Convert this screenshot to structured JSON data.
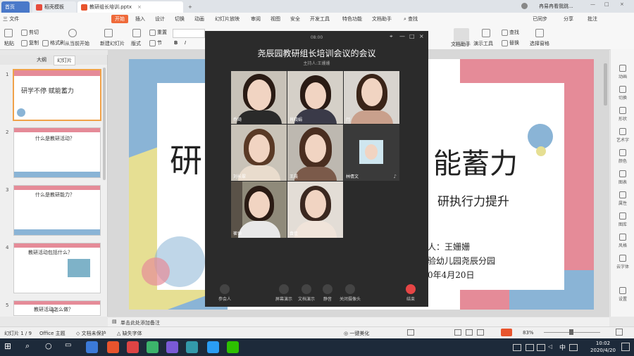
{
  "tabs": {
    "home": "首页",
    "template": "稻壳模板",
    "document": "教研组长培训.pptx",
    "new_tab": "+",
    "user": "冉易冉看我跳..."
  },
  "menu": {
    "file": "三 文件",
    "items": [
      "开始",
      "插入",
      "设计",
      "切换",
      "动画",
      "幻灯片放映",
      "审阅",
      "视图",
      "安全",
      "开发工具",
      "特色功能",
      "文档助手"
    ],
    "search": "查找",
    "sync": "已同步",
    "share": "分享",
    "annotate": "批注"
  },
  "ribbon": {
    "paste": "粘贴",
    "cut": "剪切",
    "copy": "复制",
    "format_painter": "格式刷",
    "from_current": "从当前开始",
    "new_slide": "新建幻灯片",
    "layout": "版式",
    "section": "节",
    "reset": "重置",
    "bold": "B",
    "italic": "I",
    "doc_assistant": "文档助手",
    "presenter_tools": "演示工具",
    "find": "查找",
    "replace": "替换",
    "select_pane": "选择窗格"
  },
  "left_panel": {
    "outline_tab": "大纲",
    "slides_tab": "幻灯片",
    "thumbs": [
      {
        "num": "1",
        "title": "研学不停  赋能蓄力"
      },
      {
        "num": "2",
        "title": "什么是教研活动？"
      },
      {
        "num": "3",
        "title": "什么是教研能力？"
      },
      {
        "num": "4",
        "title": "教研活动包括什么？"
      },
      {
        "num": "5",
        "title": "教研活动怎么做？"
      }
    ]
  },
  "slide": {
    "title_left": "研",
    "title_right": "能蓄力",
    "subtitle": "研执行力提升",
    "host_line": "人：王姗姗",
    "org_line": "验幼儿园尧辰分园",
    "date_line": "0年4月20日"
  },
  "meeting": {
    "time": "08:00",
    "title": "尧辰园教研组长培训会议的会议",
    "host": "主持人:王姗姗",
    "participants": [
      {
        "name": "乔琦"
      },
      {
        "name": "肖晓娟"
      },
      {
        "name": "闫"
      },
      {
        "name": "刘长翠"
      },
      {
        "name": "王晨"
      },
      {
        "name": "林倩文"
      },
      {
        "name": "崔恒"
      },
      {
        "name": "袁佳"
      }
    ],
    "controls": {
      "participants": "参会人",
      "screen_share": "屏幕演示",
      "doc_share": "文档演示",
      "mute": "静音",
      "camera_off": "关闭摄像头",
      "end": "结束"
    }
  },
  "right_tools": [
    "动画",
    "切换",
    "形状",
    "艺术字",
    "颜色",
    "图表",
    "属性",
    "图库",
    "风格",
    "云字体",
    "设置"
  ],
  "notes": "单击此处添加备注",
  "status": {
    "slide_count": "幻灯片 1 / 9",
    "theme": "Office 主题",
    "doc_protect": "文档未保护",
    "missing_font": "缺失字体",
    "beautify": "一键美化",
    "zoom": "83%"
  },
  "taskbar": {
    "time": "10:02",
    "date": "2020/4/20",
    "ime": "中"
  },
  "colors": {
    "accent": "#e8542d",
    "ribbon_tab": "#ef6a3a",
    "slide_blue": "#8ab4d6",
    "slide_pink": "#e58b98",
    "slide_yellow": "#e6df93",
    "end_red": "#e64545"
  }
}
